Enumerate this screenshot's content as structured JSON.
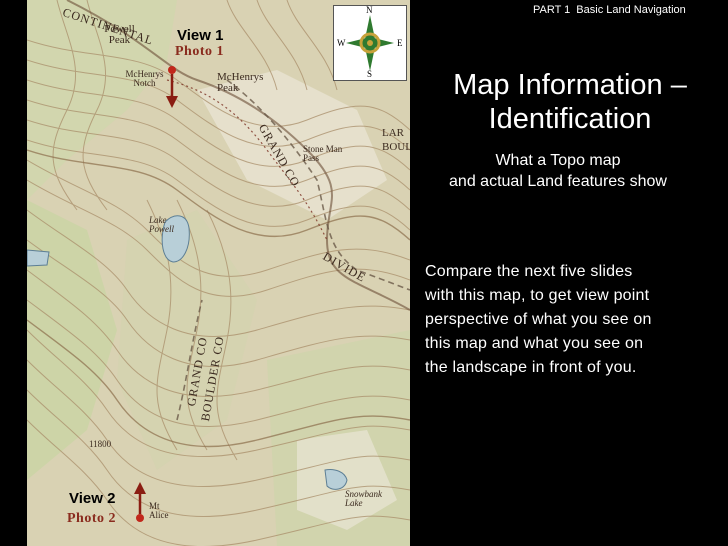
{
  "header": {
    "part": "PART 1",
    "subtitle": "Basic Land Navigation"
  },
  "title": {
    "line1": "Map Information –",
    "line2": "Identification"
  },
  "subtitle": {
    "line1": "What a Topo map",
    "line2": "and actual Land features show"
  },
  "body": {
    "lines": [
      "Compare the next five slides",
      "with this map, to get view point",
      "perspective of what you see on",
      "this map and what you see on",
      "the landscape in front of you."
    ]
  },
  "compass": {
    "n": "N",
    "s": "S",
    "e": "E",
    "w": "W"
  },
  "map": {
    "view1": "View 1",
    "photo1": "Photo 1",
    "view2": "View 2",
    "photo2": "Photo 2",
    "labels": {
      "powell_peak": "Powell Peak",
      "mchenrys_notch": "McHenrys Notch",
      "mchenrys_peak": "McHenrys Peak",
      "grand_co_1": "GRAND CO",
      "stone_man_pass": "Stone Man Pass",
      "lake_powell": "Lake Powell",
      "divide": "DIVIDE",
      "grand_co_boulder": "GRAND CO",
      "boulder_co": "BOULDER CO",
      "snowbank_lake": "Snowbank Lake",
      "mt_alice": "Mt Alice",
      "elev": "11800",
      "continental": "CONTINENTAL",
      "lar": "LAR",
      "boul": "BOUL"
    }
  },
  "colors": {
    "background": "#000000",
    "map_base": "#d9d2b3",
    "contour": "#a98e6a",
    "forest": "#c8d6a8",
    "water": "#b8cfd8",
    "marker_red": "#c1271b"
  }
}
